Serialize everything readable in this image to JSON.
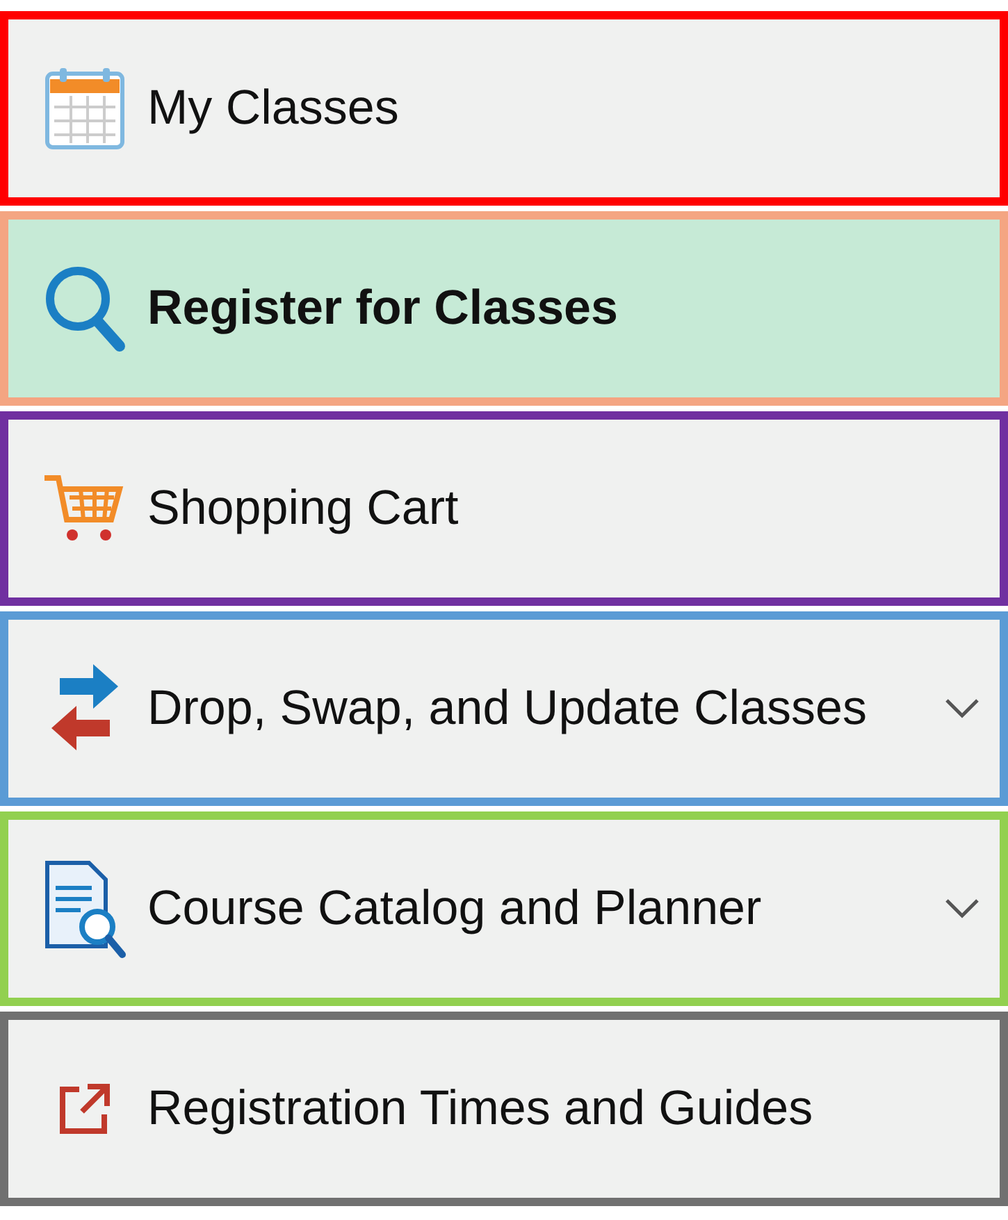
{
  "menu": {
    "items": [
      {
        "label": "My Classes",
        "selected": false,
        "has_submenu": false,
        "color": "#ff0000"
      },
      {
        "label": "Register for Classes",
        "selected": true,
        "has_submenu": false,
        "color": "#f4a582"
      },
      {
        "label": "Shopping Cart",
        "selected": false,
        "has_submenu": false,
        "color": "#7030a0"
      },
      {
        "label": "Drop, Swap, and Update Classes",
        "selected": false,
        "has_submenu": true,
        "color": "#5b9bd5"
      },
      {
        "label": "Course Catalog and Planner",
        "selected": false,
        "has_submenu": true,
        "color": "#92d050"
      },
      {
        "label": "Registration Times and Guides",
        "selected": false,
        "has_submenu": false,
        "color": "#707070"
      }
    ]
  }
}
